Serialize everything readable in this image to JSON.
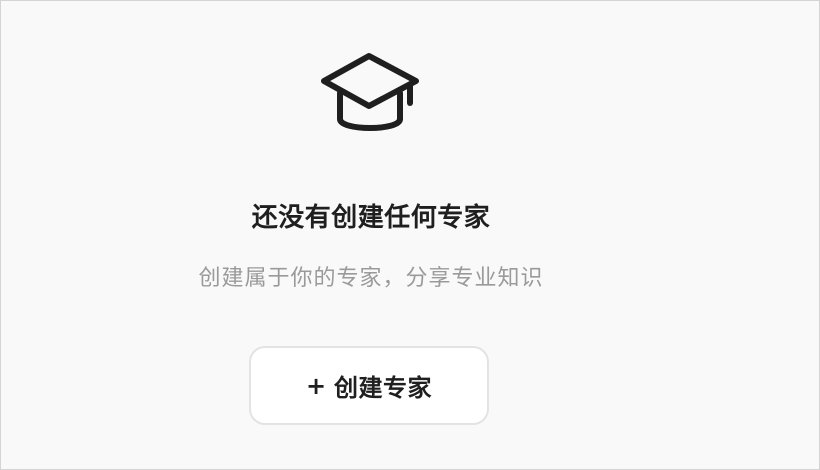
{
  "empty_state": {
    "icon": "graduation-cap-icon",
    "title": "还没有创建任何专家",
    "subtitle": "创建属于你的专家，分享专业知识",
    "create_button": {
      "icon": "plus",
      "icon_glyph": "+",
      "label": "创建专家"
    }
  }
}
